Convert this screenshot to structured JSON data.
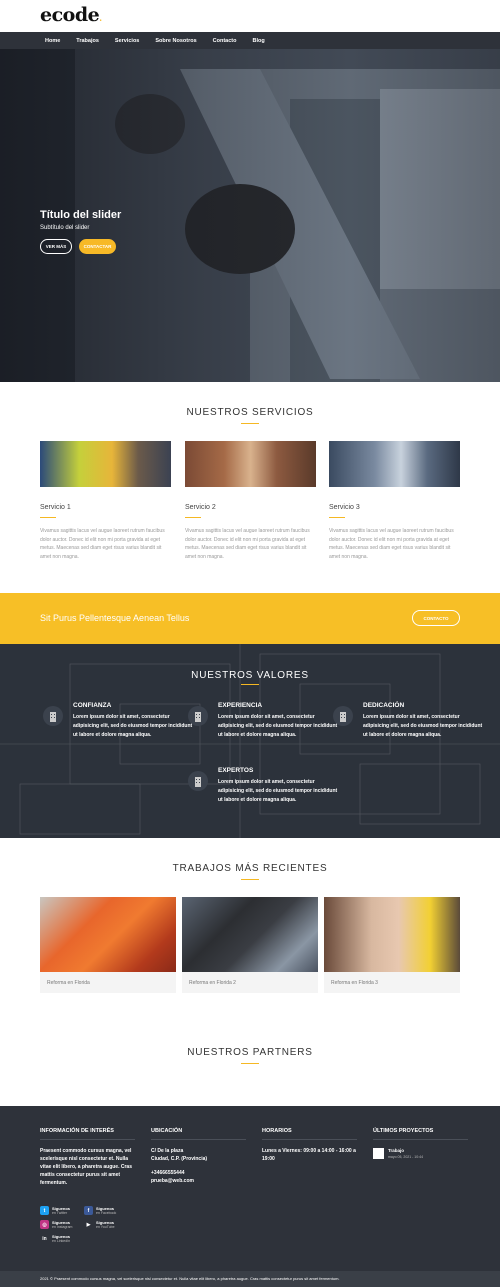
{
  "logo": "ecode",
  "nav": [
    "Home",
    "Trabajos",
    "Servicios",
    "Sobre Nosotros",
    "Contacto",
    "Blog"
  ],
  "hero": {
    "title": "Título del slider",
    "subtitle": "Subtítulo del slider",
    "btn_more": "VER MÁS",
    "btn_contact": "CONTACTAR"
  },
  "services": {
    "title": "NUESTROS SERVICIOS",
    "items": [
      {
        "name": "Servicio 1",
        "text": "Vivamus sagittis lacus vel augue laoreet rutrum faucibus dolor auctor. Donec id elit non mi porta gravida at eget metus. Maecenas sed diam eget risus varius blandit sit amet non magna."
      },
      {
        "name": "Servicio 2",
        "text": "Vivamus sagittis lacus vel augue laoreet rutrum faucibus dolor auctor. Donec id elit non mi porta gravida at eget metus. Maecenas sed diam eget risus varius blandit sit amet non magna."
      },
      {
        "name": "Servicio 3",
        "text": "Vivamus sagittis lacus vel augue laoreet rutrum faucibus dolor auctor. Donec id elit non mi porta gravida at eget metus. Maecenas sed diam eget risus varius blandit sit amet non magna."
      }
    ]
  },
  "cta": {
    "text": "Sit Purus Pellentesque Aenean Tellus",
    "button": "CONTACTO"
  },
  "values": {
    "title": "NUESTROS VALORES",
    "items": [
      {
        "name": "CONFIANZA",
        "text": "Lorem ipsum dolor sit amet, consectetur adipisicing elit, sed do eiusmod tempor incididunt ut labore et dolore magna aliqua."
      },
      {
        "name": "EXPERIENCIA",
        "text": "Lorem ipsum dolor sit amet, consectetur adipisicing elit, sed do eiusmod tempor incididunt ut labore et dolore magna aliqua."
      },
      {
        "name": "DEDICACIÓN",
        "text": "Lorem ipsum dolor sit amet, consectetur adipisicing elit, sed do eiusmod tempor incididunt ut labore et dolore magna aliqua."
      },
      {
        "name": "EXPERTOS",
        "text": "Lorem ipsum dolor sit amet, consectetur adipisicing elit, sed do eiusmod tempor incididunt ut labore et dolore magna aliqua."
      }
    ]
  },
  "works": {
    "title": "TRABAJOS MÁS RECIENTES",
    "items": [
      "Reforma en Florida",
      "Reforma en Florida 2",
      "Reforma en Florida 3"
    ]
  },
  "partners": {
    "title": "NUESTROS PARTNERS"
  },
  "footer": {
    "info_title": "INFORMACIÓN DE INTERÉS",
    "info_text": "Praesent commodo cursus magna, vel scelerisque nisl consectetur et. Nulla vitae elit libero, a pharetra augue. Cras mattis consectetur purus sit amet fermentum.",
    "location_title": "UBICACIÓN",
    "address": "C/ De la plaza",
    "city": "Ciudad, C.P. (Provincia)",
    "phone": "+34666555444",
    "email": "prueba@web.com",
    "hours_title": "HORARIOS",
    "hours": "Lunes a Viernes: 09:00 a 14:00 - 16:00 a 19:00",
    "projects_title": "ÚLTIMOS PROYECTOS",
    "project_name": "Trabajo",
    "project_date": "mayo 05, 2021 - 10:44",
    "social": [
      {
        "title": "Síguenos",
        "sub": "en Twitter",
        "icon": "twitter-icon",
        "color": "#1da1f2"
      },
      {
        "title": "Síguenos",
        "sub": "en Facebook",
        "icon": "facebook-icon",
        "color": "#3b5998"
      },
      {
        "title": "Síguenos",
        "sub": "en Instagram",
        "icon": "instagram-icon",
        "color": "#c13584"
      },
      {
        "title": "Síguenos",
        "sub": "en YouTube",
        "icon": "youtube-icon",
        "color": "#2e323a"
      },
      {
        "title": "Síguenos",
        "sub": "en LinkedIn",
        "icon": "linkedin-icon",
        "color": "#2e323a"
      }
    ],
    "copyright": "2021 © Praesent commodo cursus magna, vel scelerisque nisl consectetur et. Nulla vitae elit libero, a pharetra augue. Cras mattis consectetur purus sit amet fermentum."
  },
  "colors": {
    "accent": "#f7bf26",
    "dark": "#2e323a"
  }
}
